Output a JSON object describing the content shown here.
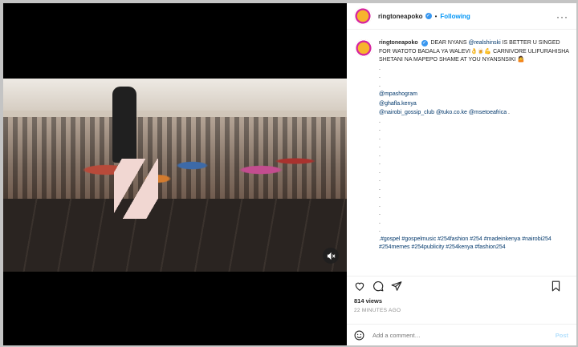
{
  "post": {
    "username": "ringtoneapoko",
    "follow_label": "Following",
    "dot": "•",
    "more_label": "···"
  },
  "caption": {
    "username": "ringtoneapoko",
    "text_before": "DEAR NYANS ",
    "mention": "@realshinski",
    "text_after": " IS BETTER U SINGED FOR WATOTO BADALA YA WALEVI👌🍺💪 CARNIVORE ULIFURAHISHA SHETANI NA MAPEPO SHAME AT YOU NYANSNSIKI 🤷",
    "dots_top": [
      ".",
      ".",
      "."
    ],
    "mentions": [
      "@mpashogram",
      "@ghafla.kenya"
    ],
    "line_mentions": {
      "a": "@nairobi_gossip_club",
      "b": "@tuko.co.ke",
      "c": "@msetoeafrica",
      "end": " ."
    },
    "dots_bottom": [
      ".",
      ".",
      ".",
      ".",
      ".",
      ".",
      ".",
      ".",
      ".",
      ".",
      ".",
      ".",
      ".",
      "."
    ],
    "hashtags": ".#gospel #gospelmusic #254fashion #254 #madeinkenya #nairobi254 #254memes #254publicity #254kenya #fashion254"
  },
  "stats": {
    "views": "814 views",
    "time": "22 MINUTES AGO"
  },
  "comment": {
    "placeholder": "Add a comment…",
    "post_label": "Post"
  },
  "icons": {
    "like": "heart-icon",
    "comment": "comment-icon",
    "share": "share-icon",
    "save": "bookmark-icon",
    "emoji": "emoji-icon",
    "mute": "muted-speaker-icon"
  },
  "colors": {
    "link": "#00376b",
    "follow": "#0095f6",
    "verified": "#3897f0"
  }
}
